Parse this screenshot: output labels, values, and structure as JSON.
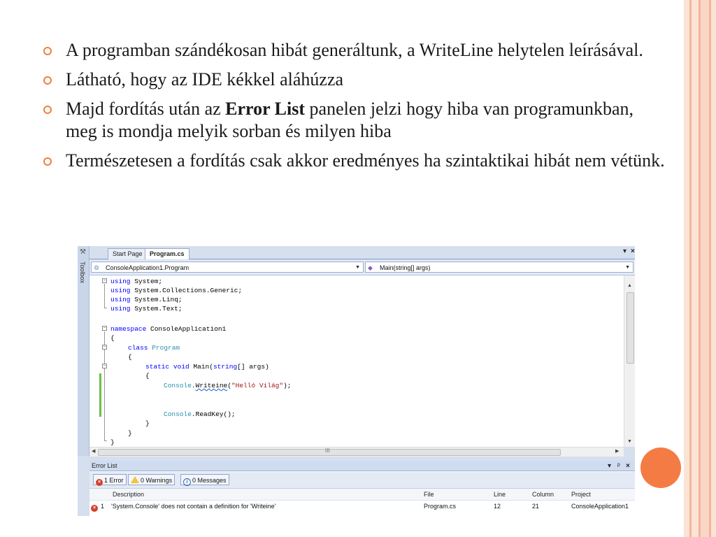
{
  "bullets": [
    {
      "text": "A programban szándékosan hibát generáltunk, a WriteLine helytelen leírásával."
    },
    {
      "text": "Látható, hogy az IDE kékkel aláhúzza"
    },
    {
      "pre": "Majd fordítás után az ",
      "bold": "Error List",
      "post": " panelen jelzi hogy hiba van programunkban, meg is mondja melyik sorban és milyen hiba"
    },
    {
      "text": "Természetesen a fordítás csak akkor eredményes ha szintaktikai hibát nem vétünk."
    }
  ],
  "colors": {
    "accent": "#f07f3c",
    "circle": "#f57b45",
    "stripe_light": "#f9d7c7",
    "stripe_mid": "#f4b49a"
  },
  "ide": {
    "toolbox_label": "Toolbox",
    "tabs": [
      {
        "label": "Start Page",
        "active": false
      },
      {
        "label": "Program.cs",
        "active": true
      }
    ],
    "tab_controls": {
      "dropdown": "▾",
      "close": "×"
    },
    "nav": {
      "class_combo": "ConsoleApplication1.Program",
      "member_combo": "Main(string[] args)"
    },
    "code": {
      "l1": {
        "kw": "using",
        "rest": " System;"
      },
      "l2": {
        "kw": "using",
        "rest": " System.Collections.Generic;"
      },
      "l3": {
        "kw": "using",
        "rest": " System.Linq;"
      },
      "l4": {
        "kw": "using",
        "rest": " System.Text;"
      },
      "l5": {
        "kw": "namespace",
        "rest": " ConsoleApplication1"
      },
      "l6": {
        "text": "{"
      },
      "l7": {
        "kw": "class",
        "ty": "Program"
      },
      "l8": {
        "text": "{"
      },
      "l9": {
        "kw1": "static",
        "kw2": "void",
        "mid": " Main(",
        "kw3": "string",
        "rest": "[] args)"
      },
      "l10": {
        "text": "{"
      },
      "l11": {
        "ty": "Console",
        "dot": ".",
        "err": "Writeine",
        "open": "(",
        "str": "\"Helló Világ\"",
        "close": ");"
      },
      "l12": {
        "ty": "Console",
        "rest": ".ReadKey();"
      },
      "l13": {
        "text": "}"
      },
      "l14": {
        "text": "}"
      },
      "l15": {
        "text": "}"
      }
    },
    "scroll_grip": "III",
    "error_list": {
      "title": "Error List",
      "controls": {
        "dropdown": "▾",
        "pin": "ᵖ",
        "close": "×"
      },
      "filters": {
        "errors": "1 Error",
        "warnings": "0 Warnings",
        "messages": "0 Messages"
      },
      "columns": [
        "Description",
        "File",
        "Line",
        "Column",
        "Project"
      ],
      "rows": [
        {
          "num": "1",
          "description": "'System.Console' does not contain a definition for 'Writeine'",
          "file": "Program.cs",
          "line": "12",
          "column": "21",
          "project": "ConsoleApplication1"
        }
      ]
    }
  }
}
